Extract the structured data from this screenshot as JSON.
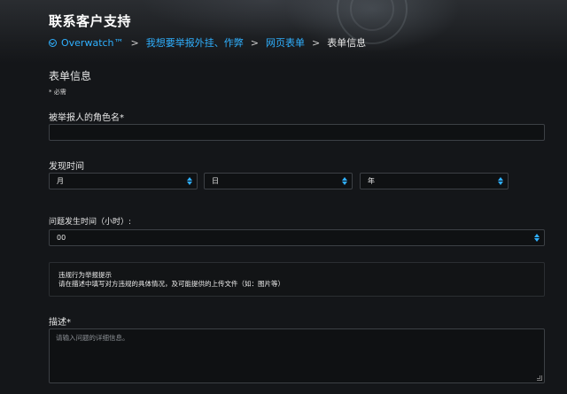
{
  "header": {
    "title": "联系客户支持"
  },
  "breadcrumb": {
    "game": "Overwatch™",
    "items": [
      "我想要举报外挂、作弊",
      "网页表单"
    ],
    "current": "表单信息",
    "icon": "overwatch-icon"
  },
  "form": {
    "heading": "表单信息",
    "required_note": "*  必需",
    "reported_name": {
      "label": "被举报人的角色名*",
      "value": ""
    },
    "discovery_time": {
      "label": "发现时间",
      "month": "月",
      "day": "日",
      "year": "年"
    },
    "hour": {
      "label": "问题发生时间（小时）:",
      "value": "00"
    },
    "notice": {
      "title": "违规行为举报提示",
      "body": "请在描述中填写对方违规的具体情况，及可能提供的上传文件（如：图片等）"
    },
    "description": {
      "label": "描述*",
      "placeholder": "请输入问题的详细信息。"
    }
  },
  "colors": {
    "accent": "#2fb0ff",
    "background": "#141619",
    "input_border": "#3c4045"
  }
}
